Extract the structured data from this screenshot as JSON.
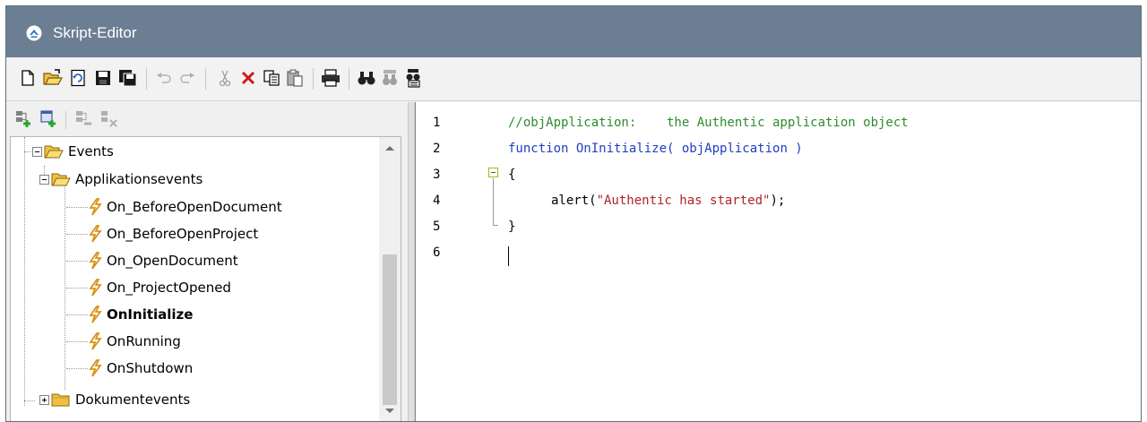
{
  "window": {
    "title": "Skript-Editor",
    "colors": {
      "titlebar": "#6c7e93",
      "comment": "#2e8b2e",
      "keyword": "#1e3ec2",
      "string": "#b22222",
      "event_icon": "#e0a020"
    }
  },
  "toolbar": {
    "items": [
      {
        "icon": "new-file-icon"
      },
      {
        "icon": "open-folder-icon"
      },
      {
        "icon": "reload-icon"
      },
      {
        "icon": "save-icon"
      },
      {
        "icon": "save-all-icon"
      },
      {
        "icon": "undo-icon"
      },
      {
        "icon": "redo-icon"
      },
      {
        "icon": "cut-icon"
      },
      {
        "icon": "delete-icon"
      },
      {
        "icon": "copy-icon"
      },
      {
        "icon": "paste-icon"
      },
      {
        "icon": "print-icon"
      },
      {
        "icon": "find-icon"
      },
      {
        "icon": "find-next-icon"
      },
      {
        "icon": "replace-icon"
      }
    ]
  },
  "left_toolbar": {
    "items": [
      {
        "icon": "add-macro-icon"
      },
      {
        "icon": "add-form-icon"
      },
      {
        "icon": "remove-macro-icon"
      },
      {
        "icon": "remove-form-icon"
      }
    ]
  },
  "tree": {
    "root": {
      "label": "Events"
    },
    "app_events": {
      "label": "Applikationsevents"
    },
    "handlers": [
      {
        "label": "On_BeforeOpenDocument"
      },
      {
        "label": "On_BeforeOpenProject"
      },
      {
        "label": "On_OpenDocument"
      },
      {
        "label": "On_ProjectOpened"
      },
      {
        "label": "OnInitialize"
      },
      {
        "label": "OnRunning"
      },
      {
        "label": "OnShutdown"
      }
    ],
    "doc_events": {
      "label": "Dokumentevents"
    }
  },
  "editor": {
    "line_numbers": [
      "1",
      "2",
      "3",
      "4",
      "5",
      "6"
    ],
    "line1_comment": "//objApplication:    the Authentic application object",
    "line2_keyword": "function",
    "line2_rest": " OnInitialize( objApplication )",
    "line3": "{",
    "line4_call": "alert(",
    "line4_string": "\"Authentic has started\"",
    "line4_end": ");",
    "line5": "}"
  }
}
